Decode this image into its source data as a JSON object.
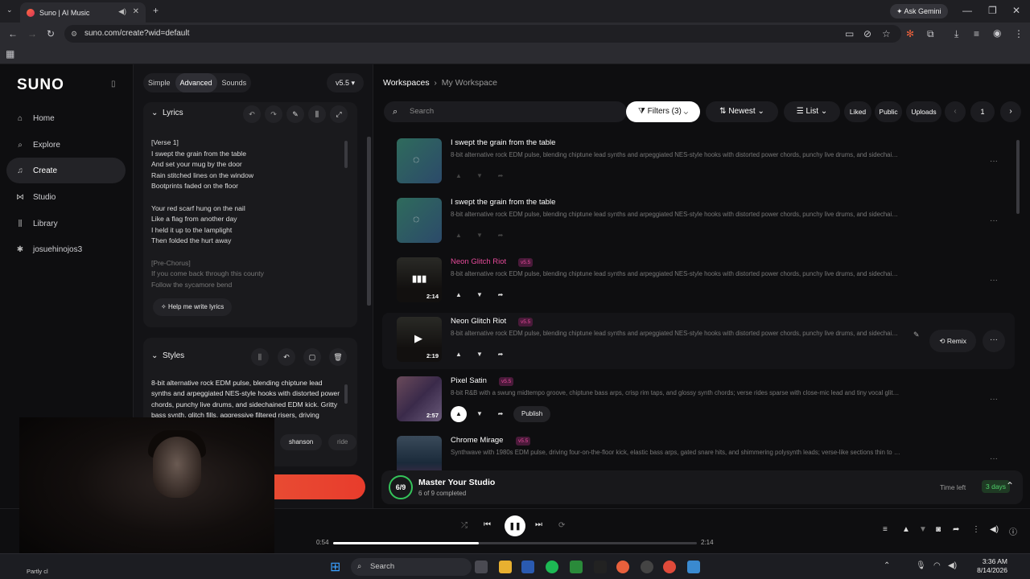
{
  "browser": {
    "tab_title": "Suno | AI Music",
    "url": "suno.com/create?wid=default",
    "gemini_label": "Ask Gemini"
  },
  "nav": {
    "logo": "SUNO",
    "items": [
      {
        "label": "Home",
        "icon": "home-icon"
      },
      {
        "label": "Explore",
        "icon": "search-icon"
      },
      {
        "label": "Create",
        "icon": "music-icon"
      },
      {
        "label": "Studio",
        "icon": "studio-icon"
      },
      {
        "label": "Library",
        "icon": "library-icon"
      },
      {
        "label": "josuehinojos3",
        "icon": "user-icon"
      }
    ]
  },
  "create": {
    "modes": [
      "Simple",
      "Advanced",
      "Sounds"
    ],
    "selected_mode": "Advanced",
    "version": "v5.5",
    "lyrics_title": "Lyrics",
    "lyrics_lines": [
      "[Verse 1]",
      "I swept the grain from the table",
      "And set your mug by the door",
      "Rain stitched lines on the window",
      "Bootprints faded on the floor",
      "",
      "Your red scarf hung on the nail",
      "Like a flag from another day",
      "I held it up to the lamplight",
      "Then folded the hurt away",
      "",
      "[Pre-Chorus]",
      "If you come back through this county",
      "Follow the sycamore bend"
    ],
    "help_button": "Help me write lyrics",
    "styles_title": "Styles",
    "styles_text": "8-bit alternative rock EDM pulse, blending chiptune lead synths and arpeggiated NES-style hooks with distorted power chords, punchy live drums, and sidechained EDM kick. Gritty bass synth, glitch fills, aggressive filtered risers, driving festival-",
    "style_chips": [
      "shanson",
      "ride"
    ],
    "create_button": "Create"
  },
  "workspace": {
    "breadcrumb_root": "Workspaces",
    "breadcrumb_current": "My Workspace",
    "search_placeholder": "Search",
    "filters_label": "Filters (3)",
    "sort_label": "Newest",
    "view_label": "List",
    "tabs": [
      "Liked",
      "Public",
      "Uploads"
    ],
    "page": "1",
    "songs": [
      {
        "title": "I swept the grain from the table",
        "version": "",
        "duration": "",
        "loading": true,
        "desc": "8-bit alternative rock EDM pulse, blending chiptune lead synths and arpeggiated NES-style hooks with distorted power chords, punchy live drums, and sidechained EDM ..."
      },
      {
        "title": "I swept the grain from the table",
        "version": "",
        "duration": "",
        "loading": true,
        "desc": "8-bit alternative rock EDM pulse, blending chiptune lead synths and arpeggiated NES-style hooks with distorted power chords, punchy live drums, and sidechained EDM ..."
      },
      {
        "title": "Neon Glitch Riot",
        "version": "v5.5",
        "duration": "2:14",
        "loading": false,
        "desc": "8-bit alternative rock EDM pulse, blending chiptune lead synths and arpeggiated NES-style hooks with distorted power chords, punchy live drums, and sidechained E..."
      },
      {
        "title": "Neon Glitch Riot",
        "version": "v5.5",
        "duration": "2:19",
        "loading": false,
        "desc": "8-bit alternative rock EDM pulse, blending chiptune lead synths and arpeggiated NES-style hooks with distorted power chords, punchy live drums, and sidechained E..."
      },
      {
        "title": "Pixel Satin",
        "version": "v5.5",
        "duration": "2:57",
        "loading": false,
        "desc": "8-bit R&B with a swung midtempo groove, chiptune bass arps, crisp rim taps, and glossy synth chords; verse rides sparse with close-mic lead and tiny vocal glitches, ..."
      },
      {
        "title": "Chrome Mirage",
        "version": "v5.5",
        "duration": "",
        "loading": false,
        "desc": "Synthwave with 1980s EDM pulse, driving four-on-the-floor kick, elastic bass arps, gated snare hits, and shimmering polysynth leads; verse-like sections thin to drum..."
      }
    ],
    "remix_label": "Remix",
    "publish_label": "Publish"
  },
  "studio": {
    "progress": "6/9",
    "title": "Master Your Studio",
    "subtitle": "6 of 9 completed",
    "time_left_label": "Time left",
    "days": "3 days"
  },
  "player": {
    "elapsed": "0:54",
    "total": "2:14",
    "progress_fraction": 0.4
  },
  "taskbar": {
    "search": "Search",
    "weather": "Partly cl",
    "time": "3:36 AM",
    "date": "8/14/2026"
  },
  "colors": {
    "accent": "#e83c2c",
    "pink": "#e54a9a",
    "green": "#34c45a"
  }
}
